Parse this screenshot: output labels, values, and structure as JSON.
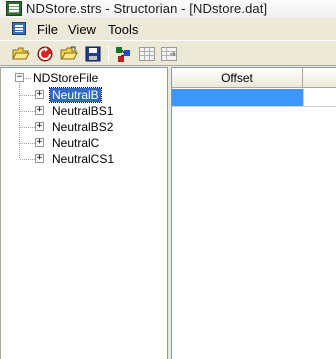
{
  "window": {
    "title": "NDStore.strs - Structorian - [NDstore.dat]"
  },
  "menu": {
    "items": [
      "File",
      "View",
      "Tools"
    ]
  },
  "toolbar": {
    "buttons": [
      {
        "name": "open-folder-icon"
      },
      {
        "name": "reload-icon"
      },
      {
        "name": "open-file-icon"
      },
      {
        "name": "save-icon"
      },
      {
        "name": "find-references-icon"
      },
      {
        "name": "table-view-icon"
      },
      {
        "name": "table-export-icon"
      }
    ]
  },
  "tree": {
    "root": "NDStoreFile",
    "children": [
      "NeutralB",
      "NeutralBS1",
      "NeutralBS2",
      "NeutralC",
      "NeutralCS1"
    ],
    "selected_index": 0,
    "expander_symbol": "+",
    "collapser_symbol": "−"
  },
  "grid": {
    "columns": [
      "Offset"
    ]
  },
  "colors": {
    "selection": "#316ac5",
    "grid_selection": "#3d95ff",
    "chrome": "#ece9d8"
  }
}
